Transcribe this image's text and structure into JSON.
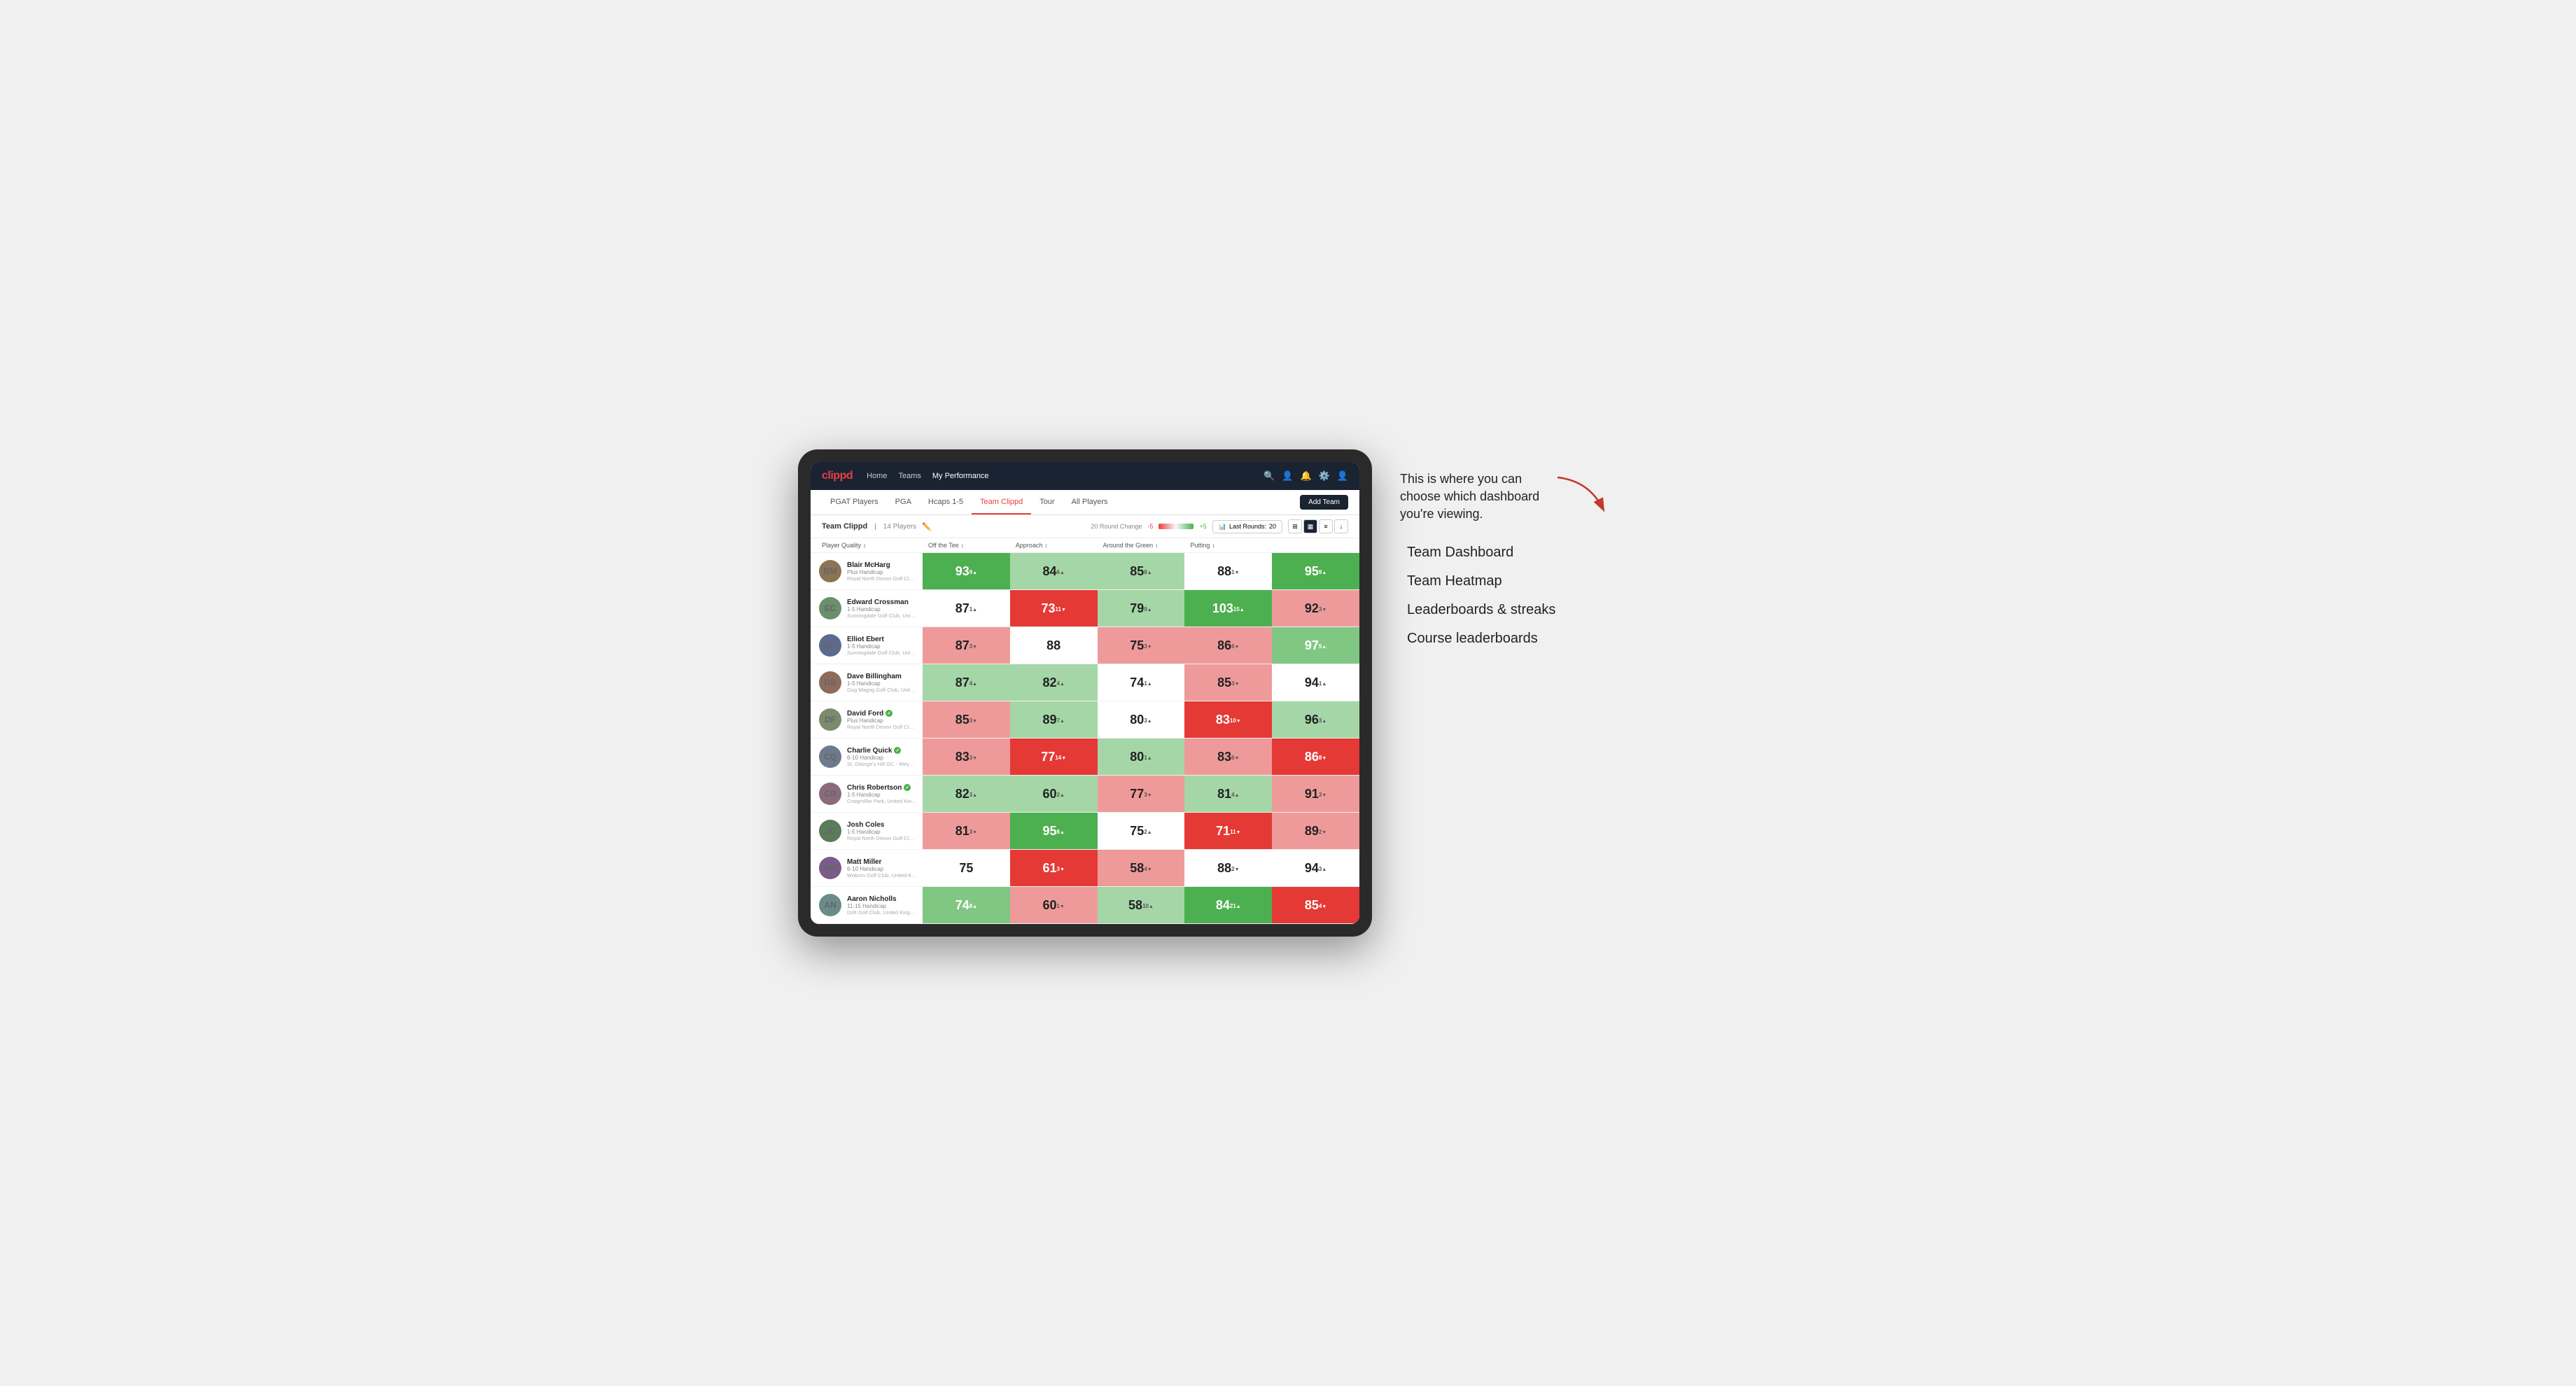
{
  "annotation": {
    "intro_text": "This is where you can choose which dashboard you're viewing.",
    "menu_items": [
      {
        "label": "Team Dashboard"
      },
      {
        "label": "Team Heatmap"
      },
      {
        "label": "Leaderboards & streaks"
      },
      {
        "label": "Course leaderboards"
      }
    ]
  },
  "nav": {
    "logo": "clippd",
    "links": [
      {
        "label": "Home",
        "active": false
      },
      {
        "label": "Teams",
        "active": false
      },
      {
        "label": "My Performance",
        "active": true
      }
    ],
    "icons": [
      "search",
      "user",
      "bell",
      "settings",
      "avatar"
    ]
  },
  "sub_tabs": [
    {
      "label": "PGAT Players",
      "active": false
    },
    {
      "label": "PGA",
      "active": false
    },
    {
      "label": "Hcaps 1-5",
      "active": false
    },
    {
      "label": "Team Clippd",
      "active": true
    },
    {
      "label": "Tour",
      "active": false
    },
    {
      "label": "All Players",
      "active": false
    }
  ],
  "add_team_btn": "Add Team",
  "team": {
    "name": "Team Clippd",
    "count": "14 Players",
    "round_change_label": "20 Round Change",
    "round_change_neg": "-5",
    "round_change_pos": "+5",
    "last_rounds_label": "Last Rounds:",
    "last_rounds_value": "20"
  },
  "col_headers": [
    {
      "label": "Player Quality",
      "arrow": "↕"
    },
    {
      "label": "Off the Tee",
      "arrow": "↕"
    },
    {
      "label": "Approach",
      "arrow": "↕"
    },
    {
      "label": "Around the Green",
      "arrow": "↕"
    },
    {
      "label": "Putting",
      "arrow": "↕"
    }
  ],
  "players": [
    {
      "name": "Blair McHarg",
      "hcp": "Plus Handicap",
      "club": "Royal North Devon Golf Club, United Kingdom",
      "avatar_class": "av-1",
      "initials": "BM",
      "scores": [
        {
          "val": "93",
          "change": "9",
          "dir": "up",
          "bg": "bg-green-strong",
          "text": "text-white"
        },
        {
          "val": "84",
          "change": "6",
          "dir": "up",
          "bg": "bg-green-light",
          "text": "text-dark"
        },
        {
          "val": "85",
          "change": "8",
          "dir": "up",
          "bg": "bg-green-light",
          "text": "text-dark"
        },
        {
          "val": "88",
          "change": "1",
          "dir": "down",
          "bg": "bg-white",
          "text": "text-dark"
        },
        {
          "val": "95",
          "change": "9",
          "dir": "up",
          "bg": "bg-green-strong",
          "text": "text-white"
        }
      ]
    },
    {
      "name": "Edward Crossman",
      "hcp": "1-5 Handicap",
      "club": "Sunningdale Golf Club, United Kingdom",
      "avatar_class": "av-2",
      "initials": "EC",
      "scores": [
        {
          "val": "87",
          "change": "1",
          "dir": "up",
          "bg": "bg-white",
          "text": "text-dark"
        },
        {
          "val": "73",
          "change": "11",
          "dir": "down",
          "bg": "bg-red-strong",
          "text": "text-white"
        },
        {
          "val": "79",
          "change": "9",
          "dir": "up",
          "bg": "bg-green-light",
          "text": "text-dark"
        },
        {
          "val": "103",
          "change": "15",
          "dir": "up",
          "bg": "bg-green-strong",
          "text": "text-white"
        },
        {
          "val": "92",
          "change": "3",
          "dir": "down",
          "bg": "bg-red-light",
          "text": "text-dark"
        }
      ]
    },
    {
      "name": "Elliot Ebert",
      "hcp": "1-5 Handicap",
      "club": "Sunningdale Golf Club, United Kingdom",
      "avatar_class": "av-3",
      "initials": "EE",
      "scores": [
        {
          "val": "87",
          "change": "3",
          "dir": "down",
          "bg": "bg-red-light",
          "text": "text-dark"
        },
        {
          "val": "88",
          "change": "",
          "dir": "",
          "bg": "bg-white",
          "text": "text-dark"
        },
        {
          "val": "75",
          "change": "3",
          "dir": "down",
          "bg": "bg-red-light",
          "text": "text-dark"
        },
        {
          "val": "86",
          "change": "6",
          "dir": "down",
          "bg": "bg-red-light",
          "text": "text-dark"
        },
        {
          "val": "97",
          "change": "5",
          "dir": "up",
          "bg": "bg-green-mid",
          "text": "text-white"
        }
      ]
    },
    {
      "name": "Dave Billingham",
      "hcp": "1-5 Handicap",
      "club": "Gog Magog Golf Club, United Kingdom",
      "avatar_class": "av-4",
      "initials": "DB",
      "scores": [
        {
          "val": "87",
          "change": "4",
          "dir": "up",
          "bg": "bg-green-light",
          "text": "text-dark"
        },
        {
          "val": "82",
          "change": "4",
          "dir": "up",
          "bg": "bg-green-light",
          "text": "text-dark"
        },
        {
          "val": "74",
          "change": "1",
          "dir": "up",
          "bg": "bg-white",
          "text": "text-dark"
        },
        {
          "val": "85",
          "change": "3",
          "dir": "down",
          "bg": "bg-red-light",
          "text": "text-dark"
        },
        {
          "val": "94",
          "change": "1",
          "dir": "up",
          "bg": "bg-white",
          "text": "text-dark"
        }
      ]
    },
    {
      "name": "David Ford",
      "badge": true,
      "hcp": "Plus Handicap",
      "club": "Royal North Devon Golf Club, United Kingdom",
      "avatar_class": "av-5",
      "initials": "DF",
      "scores": [
        {
          "val": "85",
          "change": "3",
          "dir": "down",
          "bg": "bg-red-light",
          "text": "text-dark"
        },
        {
          "val": "89",
          "change": "7",
          "dir": "up",
          "bg": "bg-green-light",
          "text": "text-dark"
        },
        {
          "val": "80",
          "change": "3",
          "dir": "up",
          "bg": "bg-white",
          "text": "text-dark"
        },
        {
          "val": "83",
          "change": "10",
          "dir": "down",
          "bg": "bg-red-strong",
          "text": "text-white"
        },
        {
          "val": "96",
          "change": "3",
          "dir": "up",
          "bg": "bg-green-light",
          "text": "text-dark"
        }
      ]
    },
    {
      "name": "Charlie Quick",
      "badge": true,
      "hcp": "6-10 Handicap",
      "club": "St. George's Hill GC - Weybridge - Surrey, Uni...",
      "avatar_class": "av-6",
      "initials": "CQ",
      "scores": [
        {
          "val": "83",
          "change": "3",
          "dir": "down",
          "bg": "bg-red-light",
          "text": "text-dark"
        },
        {
          "val": "77",
          "change": "14",
          "dir": "down",
          "bg": "bg-red-strong",
          "text": "text-white"
        },
        {
          "val": "80",
          "change": "1",
          "dir": "up",
          "bg": "bg-green-light",
          "text": "text-dark"
        },
        {
          "val": "83",
          "change": "6",
          "dir": "down",
          "bg": "bg-red-light",
          "text": "text-dark"
        },
        {
          "val": "86",
          "change": "8",
          "dir": "down",
          "bg": "bg-red-strong",
          "text": "text-white"
        }
      ]
    },
    {
      "name": "Chris Robertson",
      "badge": true,
      "hcp": "1-5 Handicap",
      "club": "Craigmillar Park, United Kingdom",
      "avatar_class": "av-7",
      "initials": "CR",
      "scores": [
        {
          "val": "82",
          "change": "3",
          "dir": "up",
          "bg": "bg-green-light",
          "text": "text-dark"
        },
        {
          "val": "60",
          "change": "2",
          "dir": "up",
          "bg": "bg-green-light",
          "text": "text-dark"
        },
        {
          "val": "77",
          "change": "3",
          "dir": "down",
          "bg": "bg-red-light",
          "text": "text-dark"
        },
        {
          "val": "81",
          "change": "4",
          "dir": "up",
          "bg": "bg-green-light",
          "text": "text-dark"
        },
        {
          "val": "91",
          "change": "3",
          "dir": "down",
          "bg": "bg-red-light",
          "text": "text-dark"
        }
      ]
    },
    {
      "name": "Josh Coles",
      "hcp": "1-5 Handicap",
      "club": "Royal North Devon Golf Club, United Kingdom",
      "avatar_class": "av-8",
      "initials": "JC",
      "scores": [
        {
          "val": "81",
          "change": "3",
          "dir": "down",
          "bg": "bg-red-light",
          "text": "text-dark"
        },
        {
          "val": "95",
          "change": "8",
          "dir": "up",
          "bg": "bg-green-strong",
          "text": "text-white"
        },
        {
          "val": "75",
          "change": "2",
          "dir": "up",
          "bg": "bg-white",
          "text": "text-dark"
        },
        {
          "val": "71",
          "change": "11",
          "dir": "down",
          "bg": "bg-red-strong",
          "text": "text-white"
        },
        {
          "val": "89",
          "change": "2",
          "dir": "down",
          "bg": "bg-red-light",
          "text": "text-dark"
        }
      ]
    },
    {
      "name": "Matt Miller",
      "hcp": "6-10 Handicap",
      "club": "Woburn Golf Club, United Kingdom",
      "avatar_class": "av-9",
      "initials": "MM",
      "scores": [
        {
          "val": "75",
          "change": "",
          "dir": "",
          "bg": "bg-white",
          "text": "text-dark"
        },
        {
          "val": "61",
          "change": "3",
          "dir": "down",
          "bg": "bg-red-strong",
          "text": "text-white"
        },
        {
          "val": "58",
          "change": "4",
          "dir": "down",
          "bg": "bg-red-light",
          "text": "text-dark"
        },
        {
          "val": "88",
          "change": "2",
          "dir": "down",
          "bg": "bg-white",
          "text": "text-dark"
        },
        {
          "val": "94",
          "change": "3",
          "dir": "up",
          "bg": "bg-white",
          "text": "text-dark"
        }
      ]
    },
    {
      "name": "Aaron Nicholls",
      "hcp": "11-15 Handicap",
      "club": "Drift Golf Club, United Kingdom",
      "avatar_class": "av-10",
      "initials": "AN",
      "scores": [
        {
          "val": "74",
          "change": "8",
          "dir": "up",
          "bg": "bg-green-mid",
          "text": "text-white"
        },
        {
          "val": "60",
          "change": "1",
          "dir": "down",
          "bg": "bg-red-light",
          "text": "text-dark"
        },
        {
          "val": "58",
          "change": "10",
          "dir": "up",
          "bg": "bg-green-light",
          "text": "text-dark"
        },
        {
          "val": "84",
          "change": "21",
          "dir": "up",
          "bg": "bg-green-strong",
          "text": "text-white"
        },
        {
          "val": "85",
          "change": "4",
          "dir": "down",
          "bg": "bg-red-strong",
          "text": "text-white"
        }
      ]
    }
  ]
}
